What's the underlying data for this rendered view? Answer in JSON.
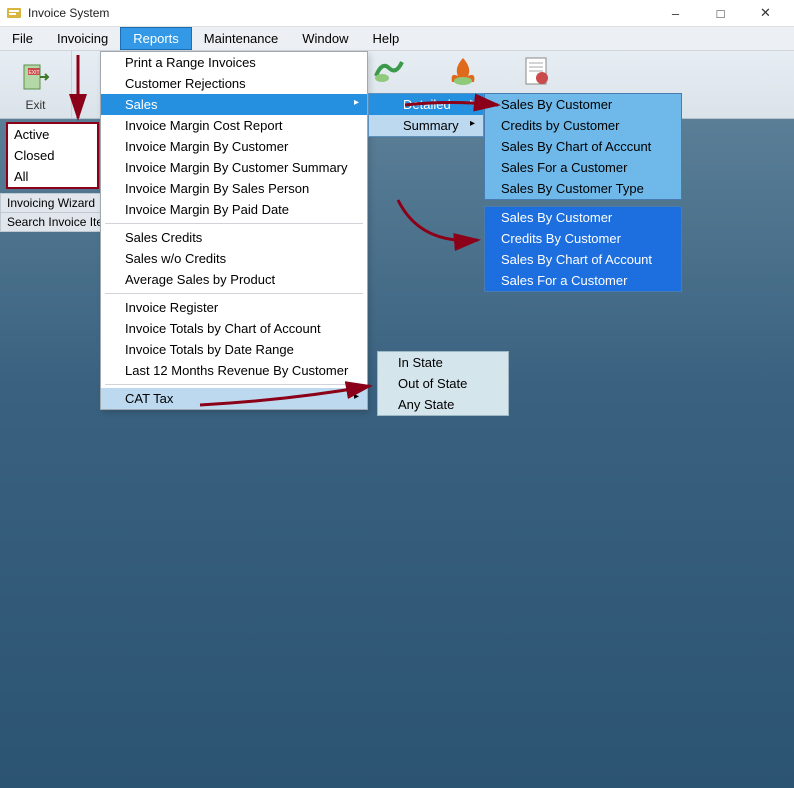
{
  "title": "Invoice System",
  "menus": [
    "File",
    "Invoicing",
    "Reports",
    "Maintenance",
    "Window",
    "Help"
  ],
  "active_menu_index": 2,
  "toolbar": {
    "exit_label": "Exit"
  },
  "sidebar": {
    "items": [
      "Active",
      "Closed",
      "All"
    ]
  },
  "sidebar_footer": [
    "Invoicing Wizard",
    "Search Invoice Items"
  ],
  "reports_menu": {
    "groups": [
      [
        "Print a Range Invoices",
        "Customer Rejections",
        {
          "label": "Sales",
          "arrow": true,
          "active": true
        },
        "Invoice Margin Cost Report",
        "Invoice Margin By Customer",
        "Invoice Margin By Customer Summary",
        "Invoice Margin By Sales Person",
        "Invoice Margin By Paid Date"
      ],
      [
        "Sales Credits",
        "Sales w/o Credits",
        "Average Sales by Product"
      ],
      [
        "Invoice Register",
        "Invoice Totals by Chart of Account",
        "Invoice Totals by Date Range",
        "Last 12 Months Revenue By Customer"
      ],
      [
        {
          "label": "CAT Tax",
          "arrow": true,
          "sub_active": true
        }
      ]
    ]
  },
  "sales_submenu": [
    {
      "label": "Detailed",
      "active": true
    },
    {
      "label": "Summary",
      "active": false
    }
  ],
  "detailed_menu": [
    "Sales By Customer",
    "Credits by Customer",
    "Sales By Chart of Acccunt",
    "Sales For a Customer",
    "Sales By Customer Type"
  ],
  "summary_menu": [
    "Sales By Customer",
    "Credits By Customer",
    "Sales By Chart of Account",
    "Sales For a Customer"
  ],
  "cat_menu": [
    "In State",
    "Out of State",
    "Any State"
  ]
}
